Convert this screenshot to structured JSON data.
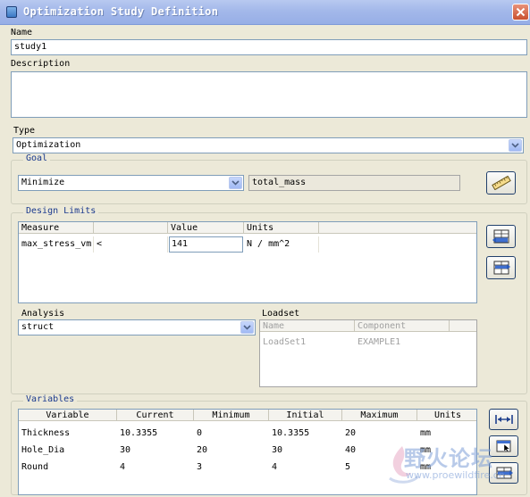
{
  "window": {
    "title": "Optimization Study Definition"
  },
  "name": {
    "label": "Name",
    "value": "study1"
  },
  "description": {
    "label": "Description",
    "value": ""
  },
  "type": {
    "label": "Type",
    "value": "Optimization"
  },
  "goal": {
    "title": "Goal",
    "mode": "Minimize",
    "measure": "total_mass"
  },
  "design_limits": {
    "title": "Design Limits",
    "headers": [
      "Measure",
      "Value",
      "Units"
    ],
    "row": {
      "measure": "max_stress_vm",
      "operator": "<",
      "value": "141",
      "units": "N / mm^2"
    }
  },
  "analysis": {
    "label": "Analysis",
    "value": "struct"
  },
  "loadset": {
    "label": "Loadset",
    "headers": [
      "Name",
      "Component"
    ],
    "row": {
      "name": "LoadSet1",
      "component": "EXAMPLE1"
    }
  },
  "variables": {
    "title": "Variables",
    "headers": [
      "Variable",
      "Current",
      "Minimum",
      "Initial",
      "Maximum",
      "Units"
    ],
    "rows": [
      {
        "variable": "Thickness",
        "current": "10.3355",
        "minimum": "0",
        "initial": "10.3355",
        "maximum": "20",
        "units": "mm"
      },
      {
        "variable": "Hole_Dia",
        "current": "30",
        "minimum": "20",
        "initial": "30",
        "maximum": "40",
        "units": "mm"
      },
      {
        "variable": "Round",
        "current": "4",
        "minimum": "3",
        "initial": "4",
        "maximum": "5",
        "units": "mm"
      }
    ]
  },
  "watermark": {
    "text_cn": "野火论坛",
    "url": "www.proewildfire.cn"
  }
}
